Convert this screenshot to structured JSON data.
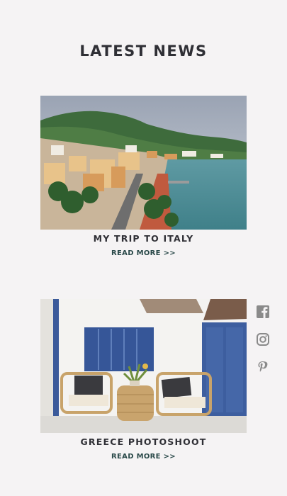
{
  "page": {
    "title": "LATEST NEWS"
  },
  "posts": [
    {
      "title": "MY TRIP TO ITALY",
      "link_label": "READ MORE >>"
    },
    {
      "title": "GREECE PHOTOSHOOT",
      "link_label": "READ MORE >>"
    }
  ],
  "social": [
    {
      "icon": "facebook-icon"
    },
    {
      "icon": "instagram-icon"
    },
    {
      "icon": "pinterest-icon"
    }
  ],
  "colors": {
    "background": "#f5f3f4",
    "text": "#2f2f35",
    "link": "#2b4a4a",
    "social_icon": "#8a8a8a"
  }
}
